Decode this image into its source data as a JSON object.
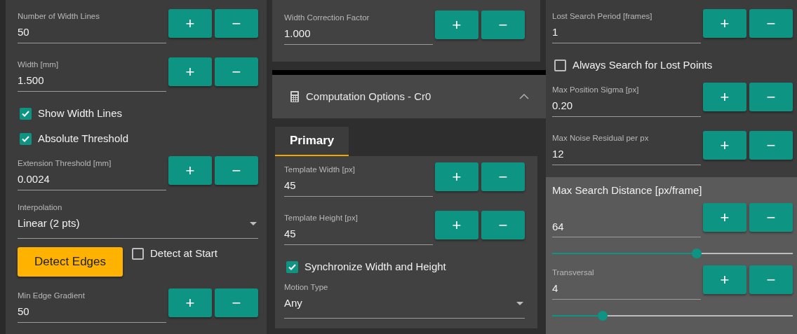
{
  "left_panel": {
    "items": [
      {
        "kind": "number",
        "label": "Number of Width Lines",
        "value": "50",
        "buttons": [
          "+",
          "−"
        ]
      },
      {
        "kind": "number",
        "label": "Width [mm]",
        "value": "1.500",
        "buttons": [
          "+",
          "−"
        ]
      },
      {
        "kind": "checkbox",
        "label": "Show Width Lines",
        "checked": true
      },
      {
        "kind": "checkbox",
        "label": "Absolute Threshold",
        "checked": true
      },
      {
        "kind": "number",
        "label": "Extension Threshold [mm]",
        "value": "0.0024",
        "buttons": [
          "+",
          "−"
        ]
      },
      {
        "kind": "select",
        "label": "Interpolation",
        "value": "Linear (2 pts)"
      },
      {
        "kind": "action",
        "button": "Detect Edges",
        "checkbox": {
          "label": "Detect at Start",
          "checked": false
        }
      },
      {
        "kind": "number",
        "label": "Min Edge Gradient",
        "value": "50",
        "buttons": [
          "+",
          "−"
        ]
      }
    ]
  },
  "middle_panel": {
    "top_items": [
      {
        "kind": "number",
        "label": "Width Correction Factor",
        "value": "1.000",
        "buttons": [
          "+",
          "−"
        ]
      }
    ],
    "section_header": {
      "title": "Computation Options - Cr0",
      "expanded": true
    },
    "tabs": [
      {
        "label": "Primary",
        "selected": true
      }
    ],
    "items": [
      {
        "kind": "number",
        "label": "Template Width [px]",
        "value": "45",
        "buttons": [
          "+",
          "−"
        ]
      },
      {
        "kind": "number",
        "label": "Template Height [px]",
        "value": "45",
        "buttons": [
          "+",
          "−"
        ]
      },
      {
        "kind": "checkbox",
        "label": "Synchronize Width and Height",
        "checked": true
      },
      {
        "kind": "select",
        "label": "Motion Type",
        "value": "Any"
      }
    ]
  },
  "right_panel": {
    "items": [
      {
        "kind": "number",
        "label": "Lost Search Period [frames]",
        "value": "1",
        "buttons": [
          "+",
          "−"
        ]
      },
      {
        "kind": "checkbox",
        "label": "Always Search for Lost Points",
        "checked": false
      },
      {
        "kind": "number",
        "label": "Max Position Sigma [px]",
        "value": "0.20",
        "buttons": [
          "+",
          "−"
        ]
      },
      {
        "kind": "number",
        "label": "Max Noise Residual per px",
        "value": "12",
        "buttons": [
          "+",
          "−"
        ]
      }
    ],
    "group": {
      "title": "Max Search Distance [px/frame]",
      "items": [
        {
          "kind": "number",
          "value": "64",
          "buttons": [
            "+",
            "−"
          ]
        },
        {
          "kind": "slider",
          "level": 0.6
        },
        {
          "kind": "number",
          "label": "Transversal",
          "value": "4",
          "buttons": [
            "+",
            "−"
          ]
        },
        {
          "kind": "slider",
          "level": 0.21
        }
      ]
    }
  }
}
